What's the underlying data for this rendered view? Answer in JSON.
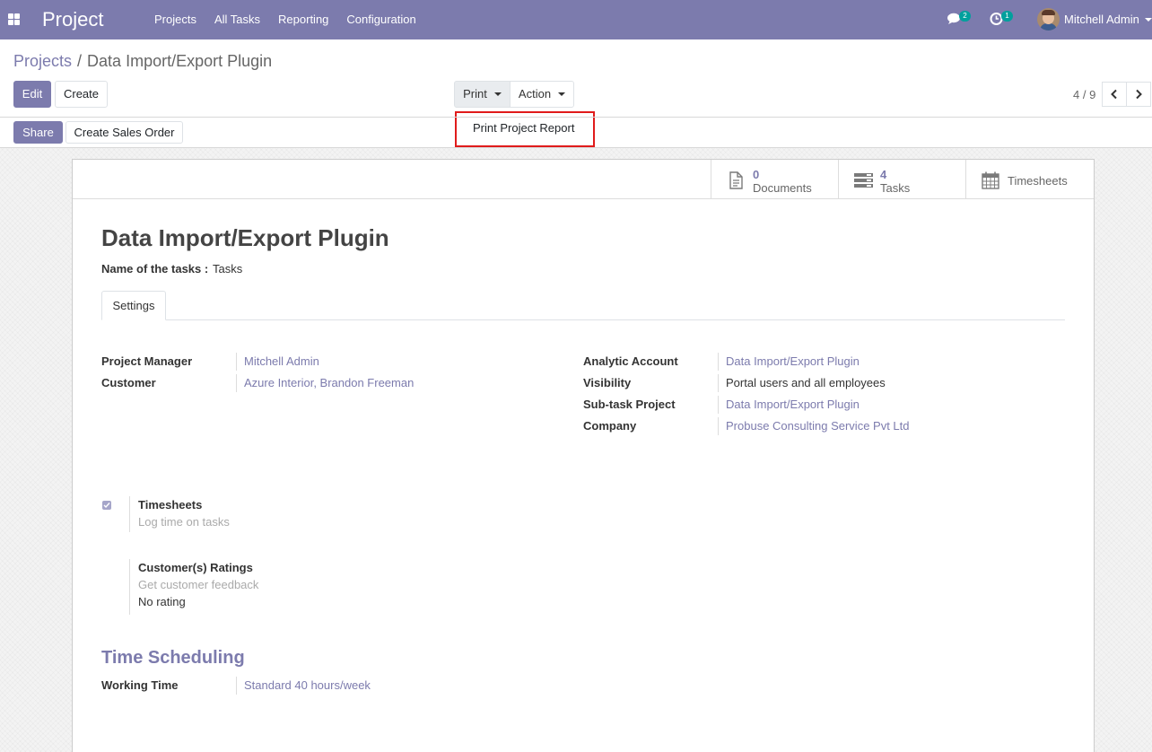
{
  "navbar": {
    "app_title": "Project",
    "menu": [
      "Projects",
      "All Tasks",
      "Reporting",
      "Configuration"
    ],
    "messages_count": "2",
    "activities_count": "1",
    "user_name": "Mitchell Admin"
  },
  "breadcrumb": {
    "parent": "Projects",
    "separator": "/",
    "current": "Data Import/Export Plugin"
  },
  "toolbar": {
    "edit_label": "Edit",
    "create_label": "Create",
    "print_label": "Print",
    "action_label": "Action",
    "share_label": "Share",
    "create_sales_order_label": "Create Sales Order",
    "pager": "4 / 9"
  },
  "print_menu": {
    "items": [
      "Print Project Report"
    ]
  },
  "button_box": {
    "documents_count": "0",
    "documents_label": "Documents",
    "tasks_count": "4",
    "tasks_label": "Tasks",
    "timesheets_label": "Timesheets"
  },
  "record": {
    "title": "Data Import/Export Plugin",
    "tasks_name_label": "Name of the tasks :",
    "tasks_name_value": "Tasks"
  },
  "tabs": [
    "Settings"
  ],
  "fields_left": [
    {
      "label": "Project Manager",
      "value": "Mitchell Admin"
    },
    {
      "label": "Customer",
      "value": "Azure Interior, Brandon Freeman"
    }
  ],
  "fields_right": [
    {
      "label": "Analytic Account",
      "value": "Data Import/Export Plugin"
    },
    {
      "label": "Visibility",
      "value": "Portal users and all employees"
    },
    {
      "label": "Sub-task Project",
      "value": "Data Import/Export Plugin"
    },
    {
      "label": "Company",
      "value": "Probuse Consulting Service Pvt Ltd"
    }
  ],
  "settings": {
    "timesheets": {
      "checked": true,
      "title": "Timesheets",
      "help": "Log time on tasks"
    },
    "ratings": {
      "title": "Customer(s) Ratings",
      "help": "Get customer feedback",
      "value": "No rating"
    }
  },
  "time_scheduling": {
    "section_title": "Time Scheduling",
    "working_time_label": "Working Time",
    "working_time_value": "Standard 40 hours/week"
  },
  "colors": {
    "brand": "#7c7bad",
    "badge": "#00a09d",
    "highlight_border": "#e01b1b"
  }
}
